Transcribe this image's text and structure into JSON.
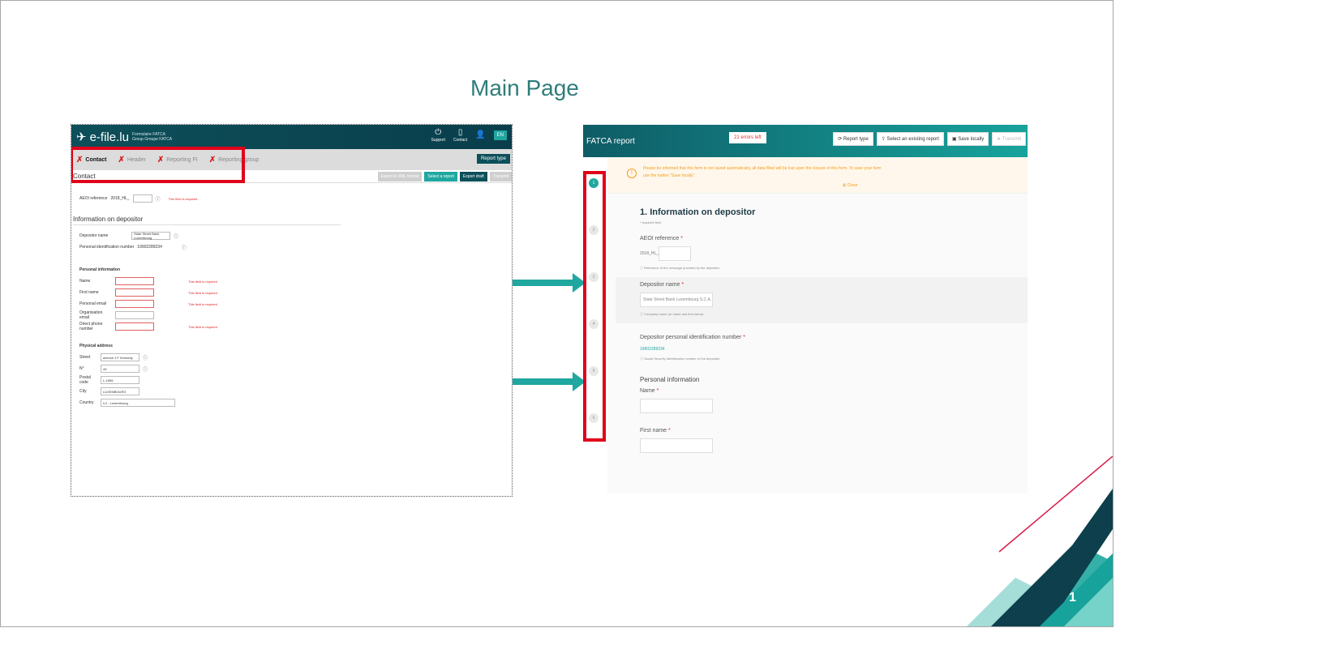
{
  "slide": {
    "title": "Main Page",
    "page_number": "1"
  },
  "left_screen": {
    "logo_text": "e-file.lu",
    "logo_sub1": "Formulaire FATCA",
    "logo_sub2": "Group Groupe FATCA",
    "top_actions": [
      {
        "label": "Support",
        "icon": "power-icon"
      },
      {
        "label": "Contact",
        "icon": "phone-icon"
      }
    ],
    "lang": "EN",
    "tabs": [
      {
        "label": "Contact",
        "active": true
      },
      {
        "label": "Header",
        "active": false
      },
      {
        "label": "Reporting FI",
        "active": false
      },
      {
        "label": "Reporting group",
        "active": false
      }
    ],
    "report_type_btn": "Report type",
    "section_title": "Contact",
    "buttons": {
      "export_xml": "Export in XML format",
      "select_report": "Select a report",
      "export_draft": "Export draft",
      "transmit": "Transmit"
    },
    "aeoi_label": "AEOI reference",
    "aeoi_prefix": "2018_HL_",
    "required_msg": "This field is required",
    "depositor_heading": "Information on depositor",
    "depositor_name_label": "Depositor name",
    "depositor_name_value": "State Street Bank Luxembourg",
    "personal_id_label": "Personal identification number",
    "personal_id_value": "19902289234",
    "personal_info_heading": "Personal information",
    "personal_fields": [
      "Name",
      "First name",
      "Personal email",
      "Organisation email",
      "Direct phone number"
    ],
    "physical_address_heading": "Physical address",
    "street_label": "Street",
    "street_value": "avenue J.F Kennedy",
    "number_label": "N°",
    "number_value": "49",
    "postal_label": "Postal code",
    "postal_value": "L-1855",
    "city_label": "City",
    "city_value": "LUXEMBOURG",
    "country_label": "Country",
    "country_value": "LU - Luxembourg"
  },
  "right_screen": {
    "title": "FATCA report",
    "errors_badge": "21 errors left",
    "actions": [
      "Report type",
      "Select an existing report",
      "Save locally",
      "Transmit"
    ],
    "warning_text": "Please be informed that this form is not saved automatically, all data filled will be lost upon the closure of this form. To save your form use the button \"Save locally\".",
    "close_label": "Close",
    "section_heading": "1. Information on depositor",
    "required_note": "* required field",
    "aeoi_label": "AEOI reference",
    "aeoi_prefix": "2018_HL_",
    "aeoi_help": "Reference of the message provided by the depositor",
    "depositor_name_label": "Depositor name",
    "depositor_name_value": "State Street Bank Luxembourg S.C.A.",
    "depositor_name_help": "Company name (or name and first name)",
    "depositor_pin_label": "Depositor personal identification number",
    "depositor_pin_value": "19902289234",
    "depositor_pin_help": "Social Security Identification number of the depositor",
    "personal_info": "Personal information",
    "name_label": "Name",
    "first_name_label": "First name",
    "steps": [
      "1",
      "2",
      "3",
      "4",
      "5",
      "6"
    ]
  },
  "colors": {
    "title": "#2e7d7a",
    "teal": "#1fa7a0",
    "dark_teal": "#0d4f5a",
    "highlight_red": "#e0001b",
    "arrow": "#1fa7a0"
  }
}
